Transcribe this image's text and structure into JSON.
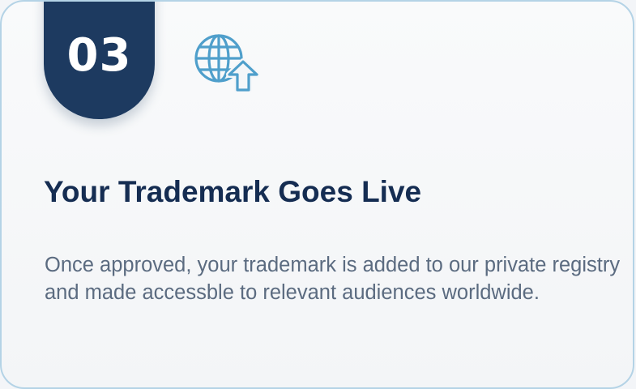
{
  "step": {
    "number": "03"
  },
  "icon": "globe-upload-icon",
  "title": "Your Trademark Goes Live",
  "description": "Once approved, your trademark is added to our private registry and made accessble to relevant audiences worldwide.",
  "colors": {
    "badge": "#1d3a60",
    "title": "#152d52",
    "body_text": "#5b6b80",
    "icon": "#4f9fcb",
    "border": "#b4d3e6",
    "background": "#f5f7f9"
  }
}
